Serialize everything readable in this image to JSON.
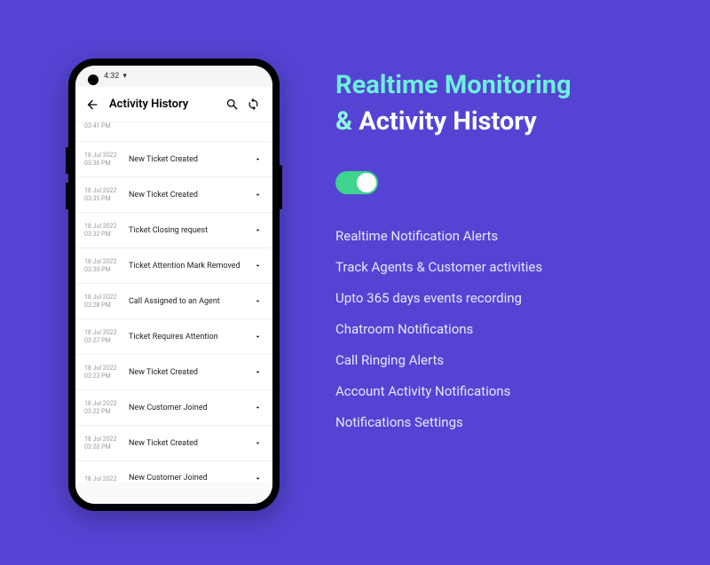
{
  "status_bar": {
    "time": "4:32",
    "icons_text": "⚙ ⚡ 📶 ⚡"
  },
  "app_bar": {
    "title": "Activity History"
  },
  "partial_top": {
    "time": "03:41 PM"
  },
  "rows": [
    {
      "date": "18 Jul 2022",
      "time": "03:36 PM",
      "title": "New Ticket Created"
    },
    {
      "date": "18 Jul 2022",
      "time": "03:35 PM",
      "title": "New Ticket Created"
    },
    {
      "date": "18 Jul 2022",
      "time": "03:32 PM",
      "title": "Ticket Closing request"
    },
    {
      "date": "18 Jul 2022",
      "time": "03:30 PM",
      "title": "Ticket Attention Mark Removed"
    },
    {
      "date": "18 Jul 2022",
      "time": "03:28 PM",
      "title": "Call Assigned to an Agent"
    },
    {
      "date": "18 Jul 2022",
      "time": "03:27 PM",
      "title": "Ticket Requires Attention"
    },
    {
      "date": "18 Jul 2022",
      "time": "03:23 PM",
      "title": "New Ticket Created"
    },
    {
      "date": "18 Jul 2022",
      "time": "03:22 PM",
      "title": "New Customer Joined"
    },
    {
      "date": "18 Jul 2022",
      "time": "03:20 PM",
      "title": "New Ticket Created"
    }
  ],
  "partial_bottom": {
    "date": "18 Jul 2022",
    "title": "New Customer Joined"
  },
  "marketing": {
    "headline_part1": "Realtime Monitoring",
    "amp": "&",
    "headline_part2": "Activity History",
    "features": [
      "Realtime Notification Alerts",
      "Track Agents & Customer activities",
      "Upto 365 days events recording",
      "Chatroom Notifications",
      "Call Ringing Alerts",
      "Account Activity Notifications",
      "Notifications Settings"
    ]
  }
}
